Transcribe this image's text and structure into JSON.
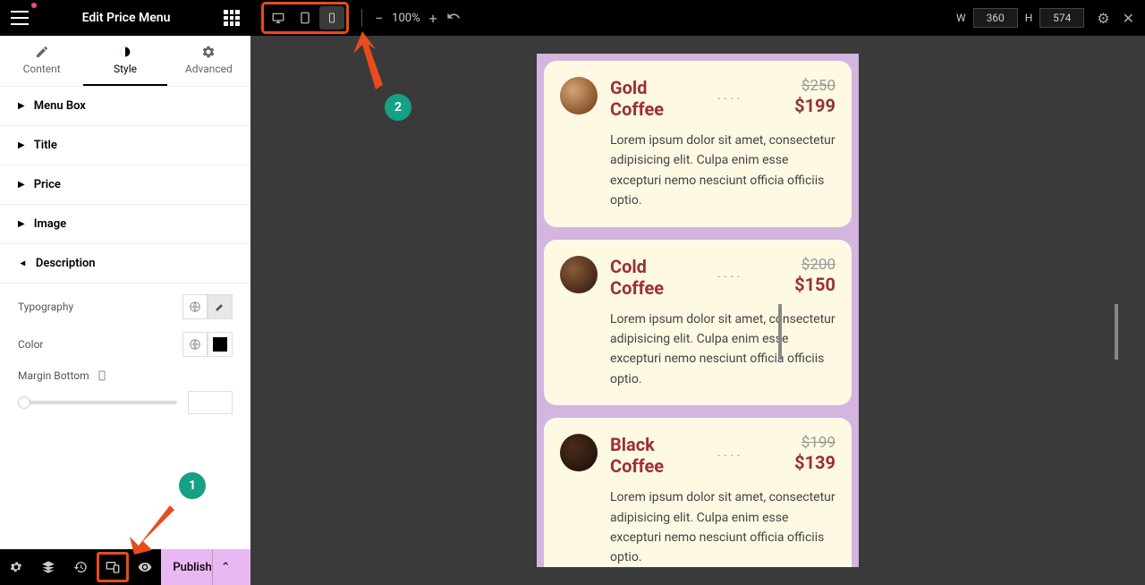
{
  "header": {
    "title": "Edit Price Menu"
  },
  "tabs": {
    "content": "Content",
    "style": "Style",
    "advanced": "Advanced"
  },
  "sections": {
    "menu_box": "Menu Box",
    "title": "Title",
    "price": "Price",
    "image": "Image",
    "description": "Description"
  },
  "controls": {
    "typography": "Typography",
    "color": "Color",
    "margin_bottom": "Margin Bottom"
  },
  "bottom": {
    "publish": "Publish"
  },
  "topbar": {
    "zoom": "100%",
    "w_label": "W",
    "h_label": "H",
    "w_value": "360",
    "h_value": "574"
  },
  "annotations": {
    "one": "1",
    "two": "2"
  },
  "menu_items": [
    {
      "name1": "Gold",
      "name2": "Coffee",
      "old": "$250",
      "new": "$199",
      "desc": "Lorem ipsum dolor sit amet, consectetur adipisicing elit. Culpa enim esse excepturi nemo nesciunt officia officiis optio."
    },
    {
      "name1": "Cold",
      "name2": "Coffee",
      "old": "$200",
      "new": "$150",
      "desc": "Lorem ipsum dolor sit amet, consectetur adipisicing elit. Culpa enim esse excepturi nemo nesciunt officia officiis optio."
    },
    {
      "name1": "Black",
      "name2": "Coffee",
      "old": "$199",
      "new": "$139",
      "desc": "Lorem ipsum dolor sit amet, consectetur adipisicing elit. Culpa enim esse excepturi nemo nesciunt officia officiis optio."
    }
  ]
}
